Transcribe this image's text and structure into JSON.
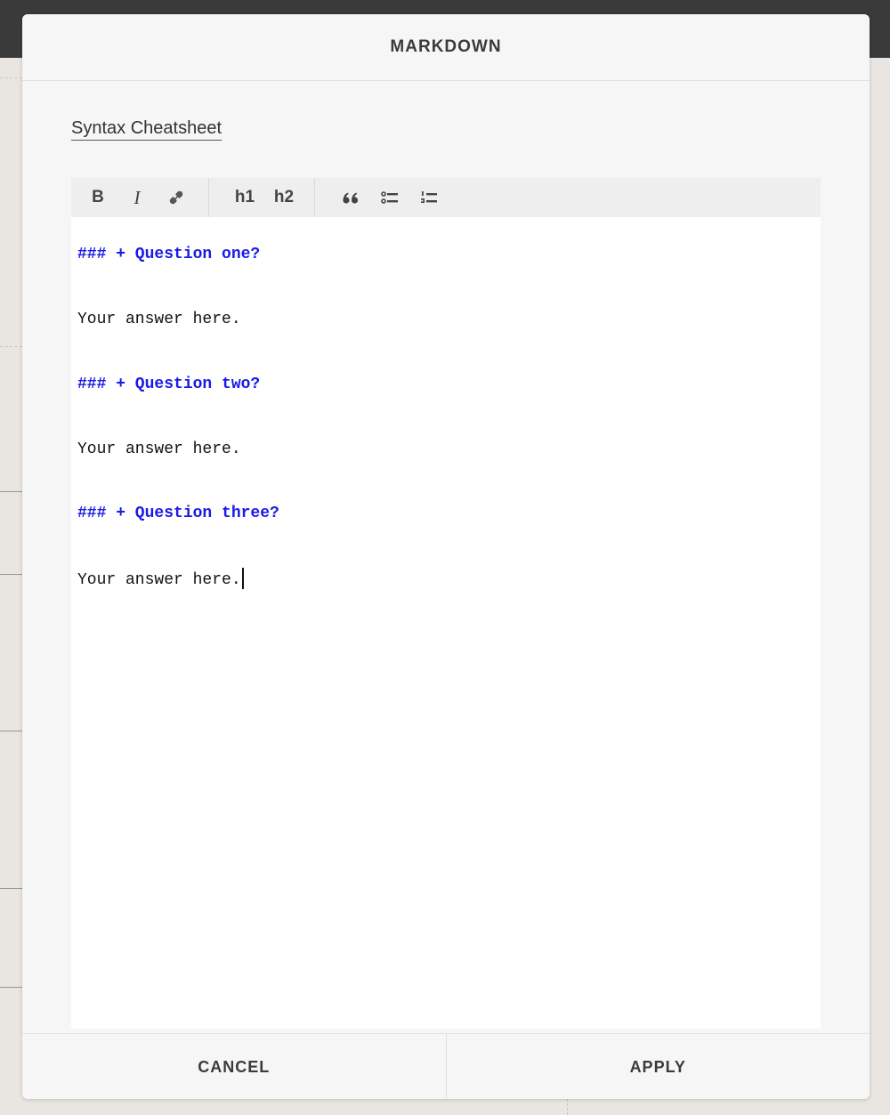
{
  "modal": {
    "title": "MARKDOWN",
    "cheatsheet_link": "Syntax Cheatsheet"
  },
  "toolbar": {
    "bold_label": "B",
    "italic_label": "I",
    "h1_label": "h1",
    "h2_label": "h2",
    "quote_label": "❝"
  },
  "editor": {
    "lines": [
      {
        "text": "### + Question one?",
        "kind": "heading"
      },
      {
        "text": "Your answer here.",
        "kind": "text"
      },
      {
        "text": "### + Question two?",
        "kind": "heading"
      },
      {
        "text": "Your answer here.",
        "kind": "text"
      },
      {
        "text": "### + Question three?",
        "kind": "heading"
      },
      {
        "text": "Your answer here.",
        "kind": "text"
      }
    ],
    "heading_color": "#1a1ae6"
  },
  "footer": {
    "cancel_label": "CANCEL",
    "apply_label": "APPLY"
  }
}
